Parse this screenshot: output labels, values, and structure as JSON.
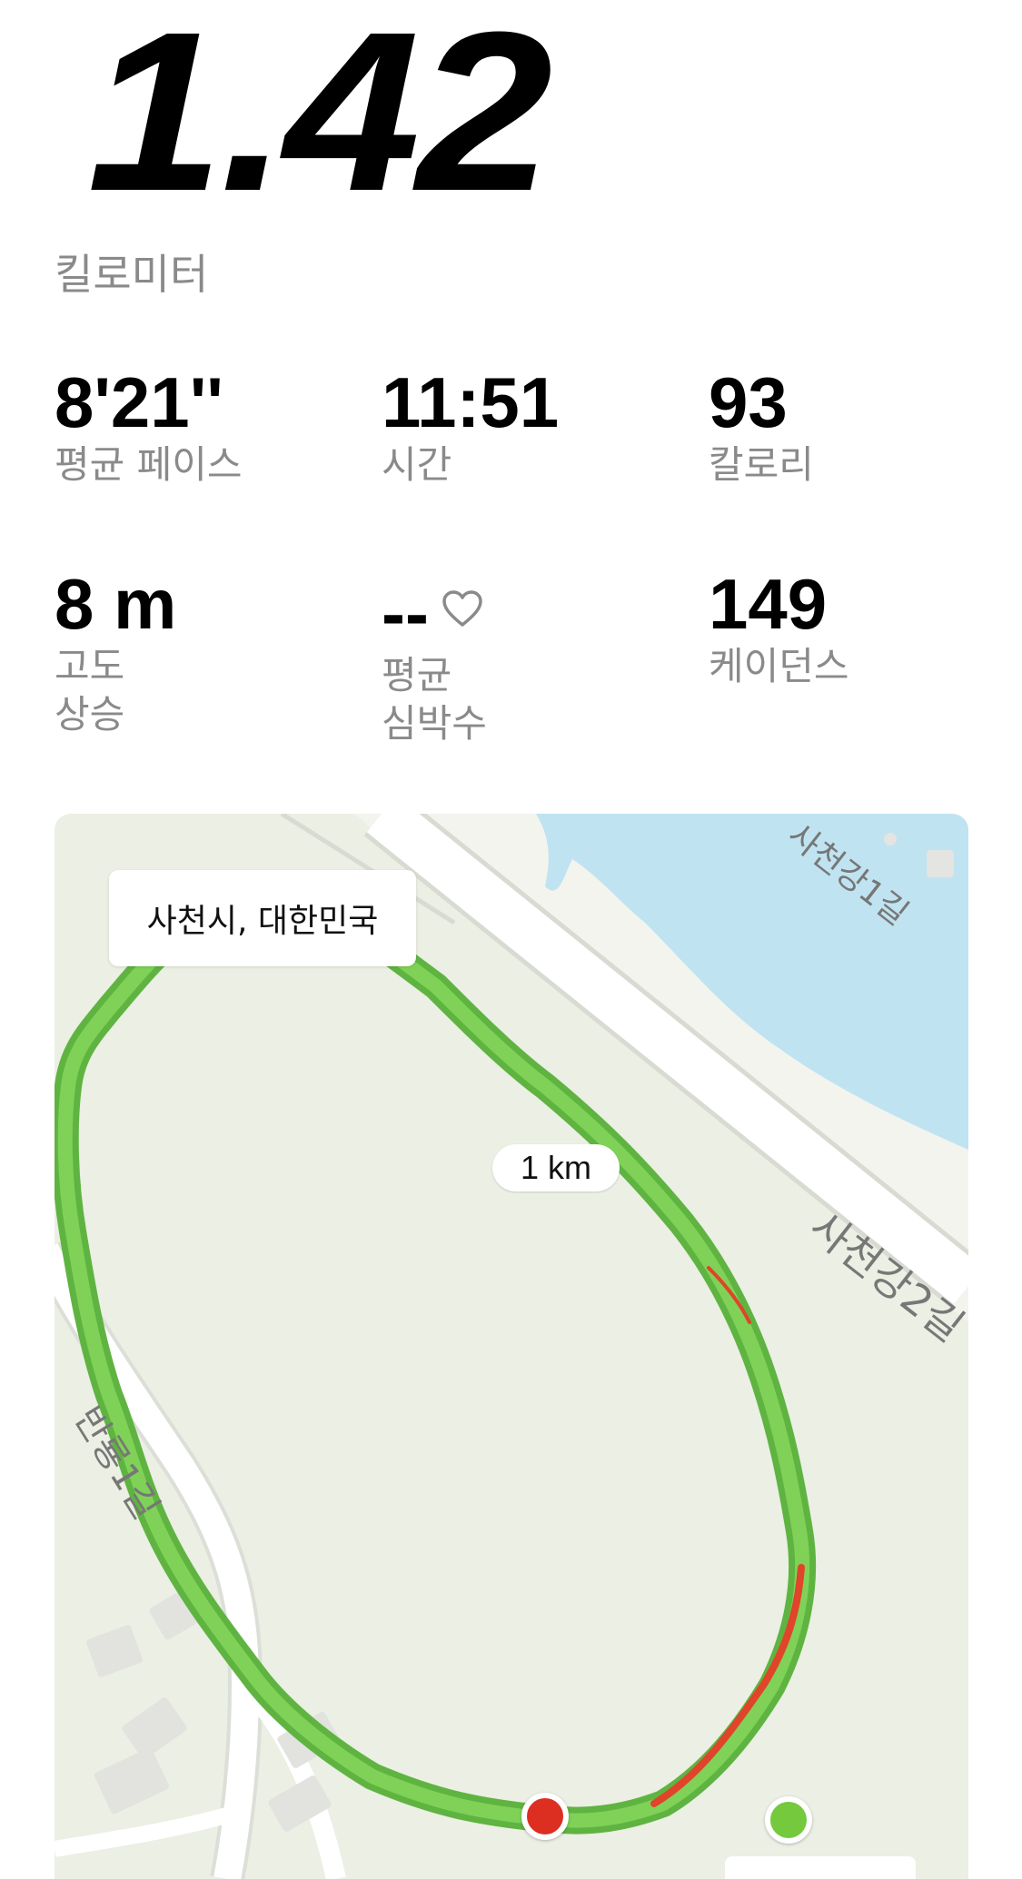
{
  "distance": {
    "value": "1.42",
    "unit": "킬로미터"
  },
  "stats": {
    "avg_pace": {
      "value": "8'21''",
      "label": "평균 페이스"
    },
    "time": {
      "value": "11:51",
      "label": "시간"
    },
    "calories": {
      "value": "93",
      "label": "칼로리"
    },
    "elevation": {
      "value": "8 m",
      "label_line1": "고도",
      "label_line2": "상승"
    },
    "heart_rate": {
      "value": "--",
      "label_line1": "평균",
      "label_line2": "심박수",
      "icon": "heart-outline-icon"
    },
    "cadence": {
      "value": "149",
      "label": "케이던스"
    }
  },
  "map": {
    "location": "사천시, 대한민국",
    "km_marker": "1 km",
    "roads": [
      "사천강1길",
      "사천강2길",
      "반룡1길"
    ],
    "route_color": "#6ccb4d",
    "route_fast_color": "#e0442a",
    "start_marker_color": "#74c93c",
    "end_marker_color": "#dd2e22",
    "water_color": "#bfe3f1"
  }
}
